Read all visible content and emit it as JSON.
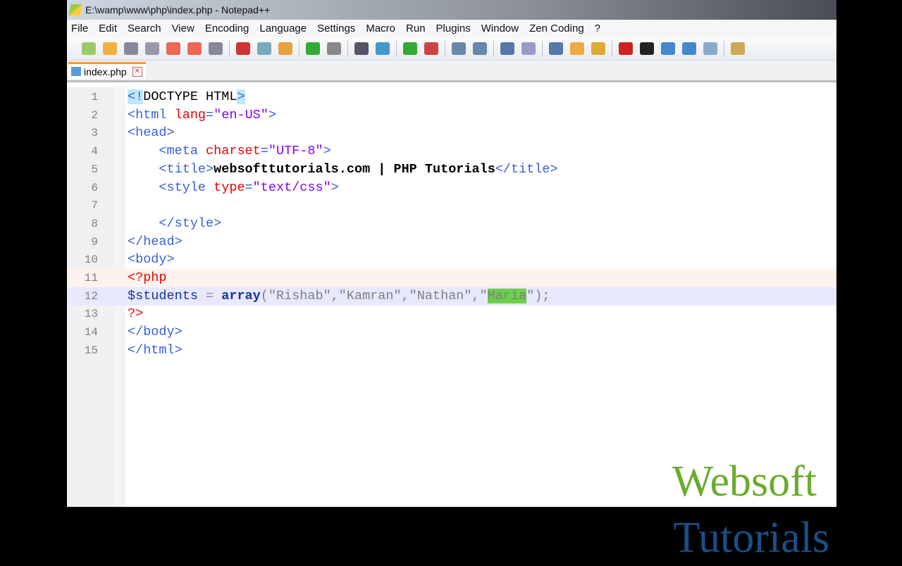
{
  "window": {
    "title": "E:\\wamp\\www\\php\\index.php - Notepad++"
  },
  "menu": [
    "File",
    "Edit",
    "Search",
    "View",
    "Encoding",
    "Language",
    "Settings",
    "Macro",
    "Run",
    "Plugins",
    "Window",
    "Zen Coding",
    "?"
  ],
  "tabs": [
    {
      "label": "index.php",
      "close": "✕"
    }
  ],
  "toolbar_icons": [
    "new-file-icon",
    "open-file-icon",
    "save-icon",
    "save-all-icon",
    "close-icon",
    "close-all-icon",
    "print-icon",
    "|",
    "cut-icon",
    "copy-icon",
    "paste-icon",
    "|",
    "undo-icon",
    "redo-icon",
    "|",
    "find-icon",
    "replace-icon",
    "|",
    "zoom-in-icon",
    "zoom-out-icon",
    "|",
    "sync-v-icon",
    "sync-h-icon",
    "|",
    "word-wrap-icon",
    "show-all-chars-icon",
    "|",
    "indent-guide-icon",
    "user-lang-icon",
    "doc-map-icon",
    "|",
    "record-macro-icon",
    "stop-macro-icon",
    "play-macro-icon",
    "run-macro-multiple-icon",
    "save-macro-icon",
    "|",
    "plugin-icon"
  ],
  "editor": {
    "current_line": 12,
    "selected_text": "Maria",
    "lines": [
      [
        [
          "<!",
          "t hl"
        ],
        [
          "DOCTYPE HTML",
          "d"
        ],
        [
          ">",
          "t hl"
        ]
      ],
      [
        [
          "<html ",
          "t"
        ],
        [
          "lang",
          "a"
        ],
        [
          "=",
          "t"
        ],
        [
          "\"en-US\"",
          "s"
        ],
        [
          ">",
          "t"
        ]
      ],
      [
        [
          "<head>",
          "t"
        ]
      ],
      [
        [
          "    "
        ],
        [
          "<meta ",
          "t"
        ],
        [
          "charset",
          "a"
        ],
        [
          "=",
          "t"
        ],
        [
          "\"UTF-8\"",
          "s"
        ],
        [
          ">",
          "t"
        ]
      ],
      [
        [
          "    "
        ],
        [
          "<title>",
          "t"
        ],
        [
          "websofttutorials.com | PHP Tutorials",
          "k"
        ],
        [
          "</title>",
          "t"
        ]
      ],
      [
        [
          "    "
        ],
        [
          "<style ",
          "t"
        ],
        [
          "type",
          "a"
        ],
        [
          "=",
          "t"
        ],
        [
          "\"text/css\"",
          "s"
        ],
        [
          ">",
          "t"
        ]
      ],
      [
        [
          "    "
        ]
      ],
      [
        [
          "    "
        ],
        [
          "</style>",
          "t"
        ]
      ],
      [
        [
          "</head>",
          "t"
        ]
      ],
      [
        [
          "<body>",
          "t"
        ]
      ],
      [
        [
          "<?php",
          "pt"
        ]
      ],
      [
        [
          "$students",
          "pv"
        ],
        [
          " = ",
          "po"
        ],
        [
          "array",
          "pk"
        ],
        [
          "(\"Rishab\",\"Kamran\",\"Nathan\",\"",
          "ps"
        ],
        [
          "Maria",
          "sel"
        ],
        [
          "\");",
          "ps"
        ]
      ],
      [
        [
          "?>",
          "pt"
        ]
      ],
      [
        [
          "</body>",
          "t"
        ]
      ],
      [
        [
          "</html>",
          "t"
        ]
      ]
    ]
  },
  "watermark": {
    "line1": "Websoft",
    "line2": "Tutorials"
  }
}
